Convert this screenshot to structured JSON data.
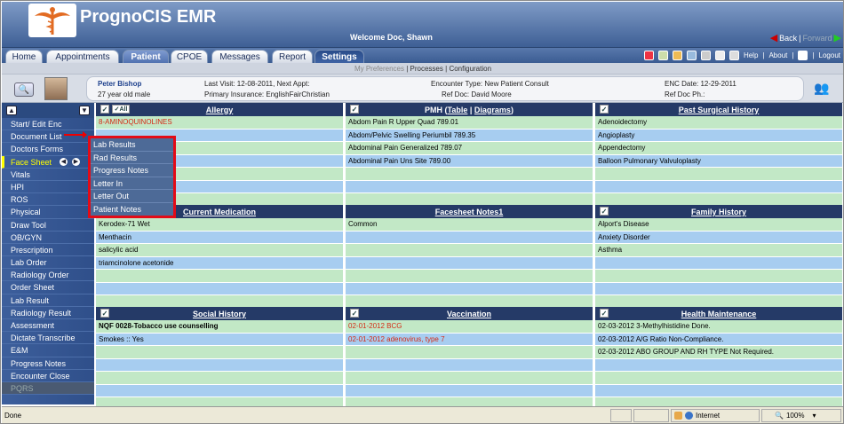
{
  "app": {
    "title": "PrognoCIS EMR",
    "welcome": "Welcome Doc, Shawn",
    "back": "Back",
    "forward": "Forward"
  },
  "tabs": [
    "Home",
    "Appointments",
    "Patient",
    "CPOE",
    "Messages",
    "Report",
    "Settings"
  ],
  "toolbar": {
    "help": "Help",
    "about": "About",
    "logout": "Logout"
  },
  "subnav": {
    "prefs": "My Preferences",
    "processes": "Processes",
    "config": "Configuration",
    "sep": "|"
  },
  "patient": {
    "name": "Peter Bishop",
    "age": "27 year old male",
    "last_visit": "Last Visit: 12-08-2011, Next Appt:",
    "insurance": "Primary Insurance: EnglishFairChristian",
    "encounter_type": "Encounter Type: New Patient Consult",
    "ref_doc": "Ref Doc: David Moore",
    "enc_date": "ENC Date: 12-29-2011",
    "ref_doc_ph": "Ref Doc Ph.:"
  },
  "sidebar": {
    "items": [
      "Start/ Edit Enc",
      "Document List",
      "Doctors Forms",
      "Face Sheet",
      "Vitals",
      "HPI",
      "ROS",
      "Physical",
      "Draw Tool",
      "OB/GYN",
      "Prescription",
      "Lab Order",
      "Radiology Order",
      "Order Sheet",
      "Lab Result",
      "Radiology Result",
      "Assessment",
      "Dictate Transcribe",
      "E&M",
      "Progress Notes",
      "Encounter Close",
      "PQRS"
    ]
  },
  "popup": {
    "items": [
      "Lab Results",
      "Rad Results",
      "Progress Notes",
      "Letter In",
      "Letter Out",
      "Patient Notes"
    ]
  },
  "panels": {
    "allergy": {
      "title": "Allergy",
      "all": "All",
      "rows": [
        "8-AMINOQUINOLINES"
      ]
    },
    "pmh": {
      "title_prefix": "PMH (",
      "table": "Table",
      "sep": " | ",
      "diagrams": "Diagrams",
      "title_suffix": ")",
      "rows": [
        "Abdom Pain R Upper Quad 789.01",
        "Abdom/Pelvic Swelling Periumbil 789.35",
        "Abdominal Pain Generalized 789.07",
        "Abdominal Pain Uns Site 789.00"
      ]
    },
    "psh": {
      "title": "Past Surgical History",
      "rows": [
        "Adenoidectomy",
        "Angioplasty",
        "Appendectomy",
        "Balloon Pulmonary Valvuloplasty"
      ]
    },
    "meds": {
      "title": "Current Medication",
      "rows": [
        "Kerodex-71 Wet",
        "Menthacin",
        "salicylic acid",
        "triamcinolone acetonide"
      ]
    },
    "notes": {
      "title": "Facesheet Notes1",
      "rows": [
        "Common"
      ]
    },
    "family": {
      "title": "Family History",
      "rows": [
        "Alport's Disease",
        "Anxiety Disorder",
        "Asthma"
      ]
    },
    "social": {
      "title": "Social History",
      "rows": [
        "NQF 0028-Tobacco use counselling",
        "Smokes :: Yes"
      ]
    },
    "vacc": {
      "title": "Vaccination",
      "rows": [
        "02-01-2012 BCG",
        "02-01-2012 adenovirus, type 7"
      ]
    },
    "health": {
      "title": "Health Maintenance",
      "rows": [
        "02-03-2012 3-Methylhistidine Done.",
        "02-03-2012 A/G Ratio Non-Compliance.",
        "02-03-2012 ABO GROUP AND RH TYPE Not Required."
      ]
    }
  },
  "status": {
    "left": "Done",
    "zone": "Internet",
    "zoom": "100%"
  }
}
